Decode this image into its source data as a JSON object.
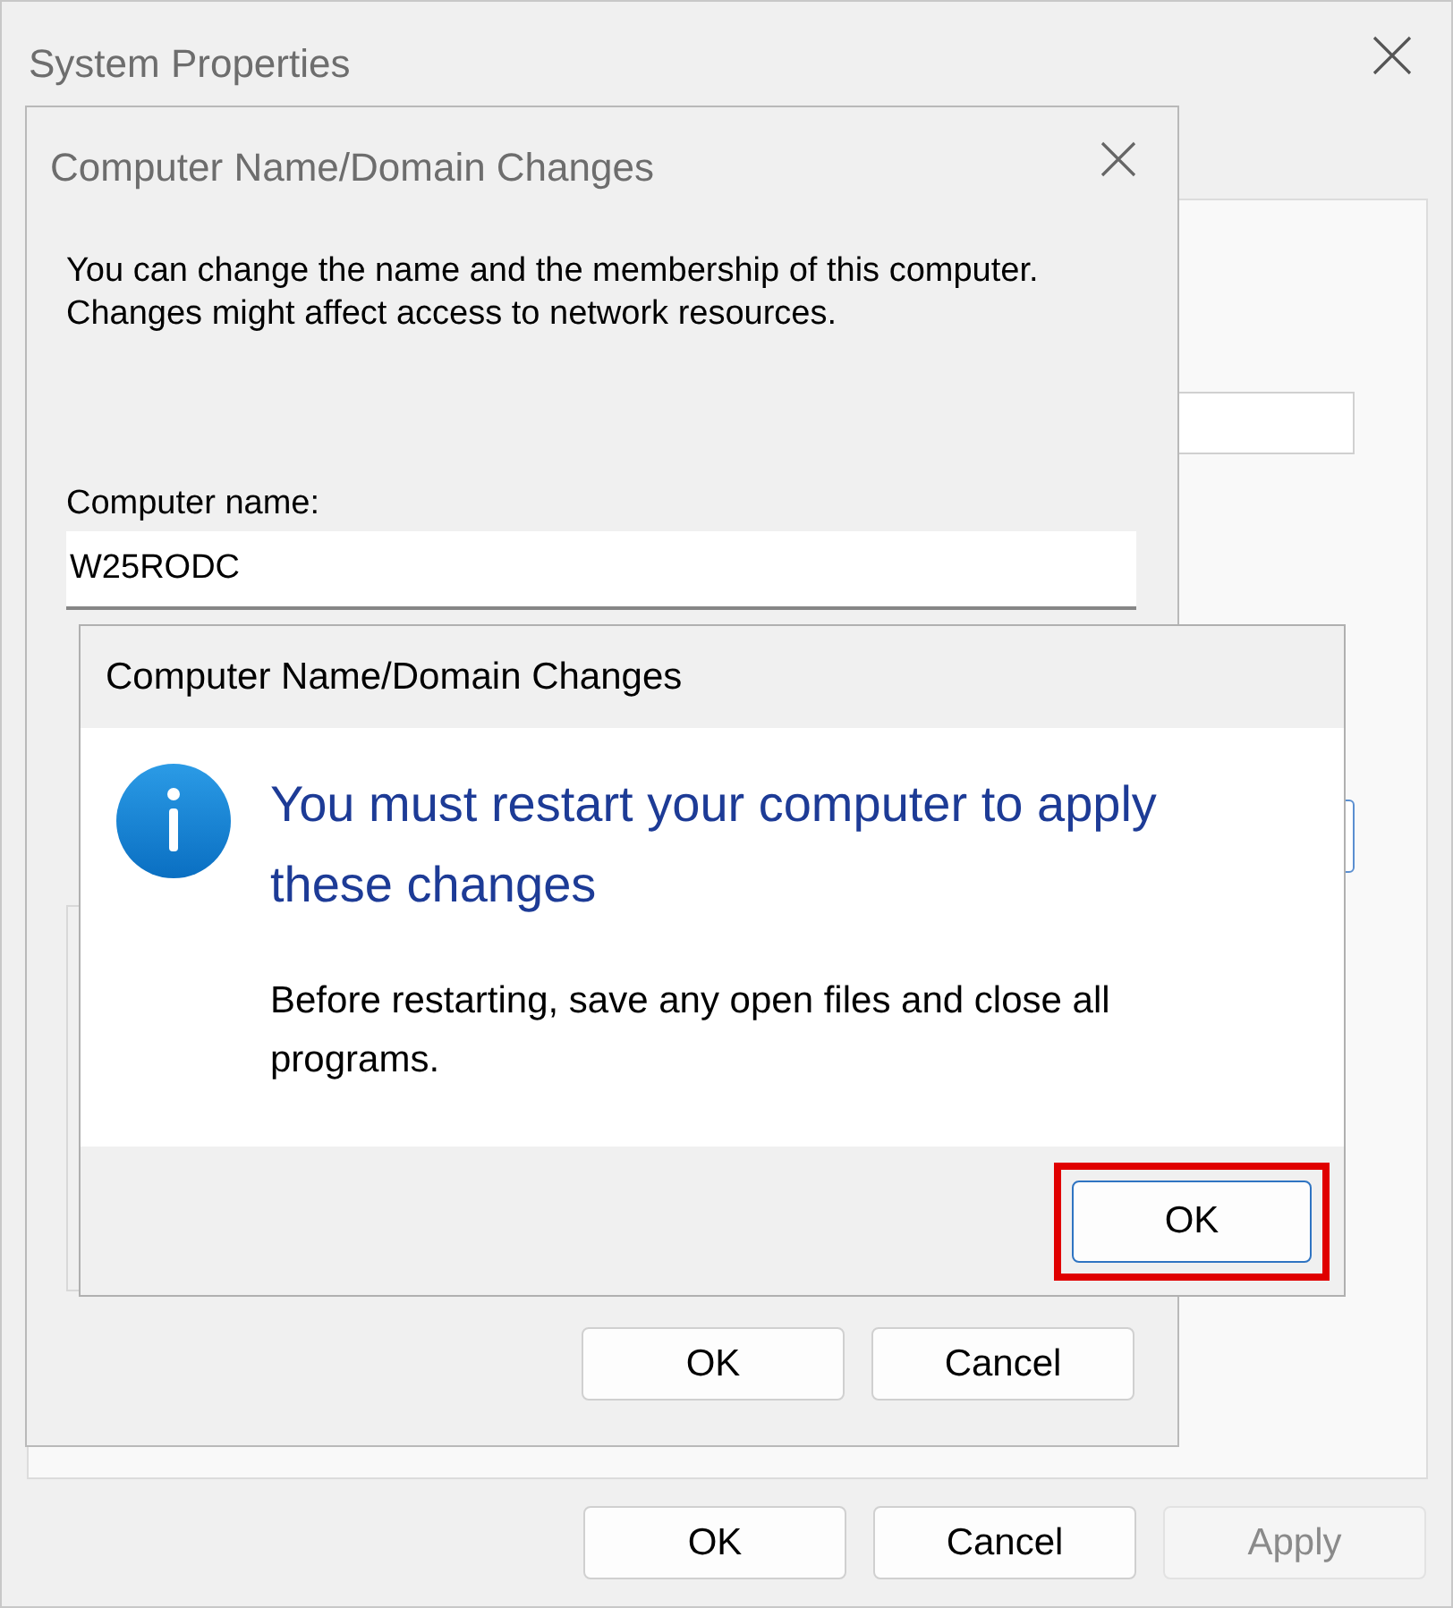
{
  "system_properties": {
    "title": "System Properties",
    "buttons": [
      {
        "label": "OK",
        "disabled": false
      },
      {
        "label": "Cancel",
        "disabled": false
      },
      {
        "label": "Apply",
        "disabled": true
      }
    ]
  },
  "name_changes": {
    "title": "Computer Name/Domain Changes",
    "intro": "You can change the name and the membership of this computer. Changes might affect access to network resources.",
    "computer_name_label": "Computer name:",
    "computer_name_value": "W25RODC",
    "buttons": [
      {
        "label": "OK",
        "disabled": false
      },
      {
        "label": "Cancel",
        "disabled": false
      }
    ]
  },
  "message_box": {
    "title": "Computer Name/Domain Changes",
    "heading": "You must restart your computer to apply these changes",
    "body": "Before restarting, save any open files and close all programs.",
    "button": {
      "label": "OK",
      "highlighted": true
    }
  }
}
